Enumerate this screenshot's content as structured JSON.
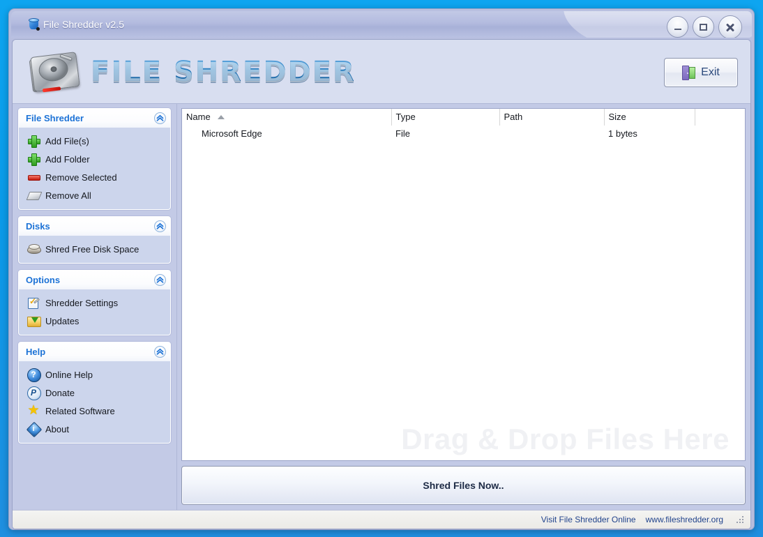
{
  "window": {
    "title": "File Shredder v2.5",
    "title_icon": "shredder-bin-icon",
    "controls": {
      "minimize": "minimize-icon",
      "maximize": "maximize-icon",
      "close": "close-icon"
    }
  },
  "header": {
    "logo_icon": "hard-drive-icon",
    "wordmark": "FILE SHREDDER",
    "exit_label": "Exit",
    "exit_icon": "exit-door-icon"
  },
  "sidebar": {
    "panels": [
      {
        "title": "File Shredder",
        "collapse_icon": "chevron-up-icon",
        "items": [
          {
            "label": "Add File(s)",
            "icon": "green-plus-icon"
          },
          {
            "label": "Add Folder",
            "icon": "green-plus-icon"
          },
          {
            "label": "Remove Selected",
            "icon": "red-minus-icon"
          },
          {
            "label": "Remove All",
            "icon": "eraser-icon"
          }
        ]
      },
      {
        "title": "Disks",
        "collapse_icon": "chevron-up-icon",
        "items": [
          {
            "label": "Shred Free Disk Space",
            "icon": "disks-icon"
          }
        ]
      },
      {
        "title": "Options",
        "collapse_icon": "chevron-up-icon",
        "items": [
          {
            "label": "Shredder Settings",
            "icon": "settings-checklist-icon"
          },
          {
            "label": "Updates",
            "icon": "updates-download-icon"
          }
        ]
      },
      {
        "title": "Help",
        "collapse_icon": "chevron-up-icon",
        "items": [
          {
            "label": "Online Help",
            "icon": "question-mark-icon"
          },
          {
            "label": "Donate",
            "icon": "paypal-icon"
          },
          {
            "label": "Related Software",
            "icon": "star-icon"
          },
          {
            "label": "About",
            "icon": "info-diamond-icon"
          }
        ]
      }
    ]
  },
  "filelist": {
    "columns": [
      {
        "label": "Name",
        "sort": "ascending"
      },
      {
        "label": "Type",
        "sort": "none"
      },
      {
        "label": "Path",
        "sort": "none"
      },
      {
        "label": "Size",
        "sort": "none"
      },
      {
        "label": "",
        "sort": "none"
      }
    ],
    "rows": [
      {
        "name": "Microsoft Edge",
        "type": "File",
        "path": "",
        "size": "1 bytes"
      }
    ],
    "watermark": "Drag & Drop Files Here"
  },
  "actions": {
    "shred_label": "Shred Files Now.."
  },
  "statusbar": {
    "visit_text": "Visit File Shredder Online",
    "site_url": "www.fileshredder.org",
    "grip_icon": "resize-grip-icon"
  },
  "colors": {
    "desktop": "#0ea5f0",
    "frame": "#b3bbdf",
    "panel_body": "#ccd5ec",
    "panel_title": "#1c72d6",
    "wordmark": "#2a7dbe",
    "status_text": "#22448c",
    "watermark": "#f0f1f4"
  }
}
